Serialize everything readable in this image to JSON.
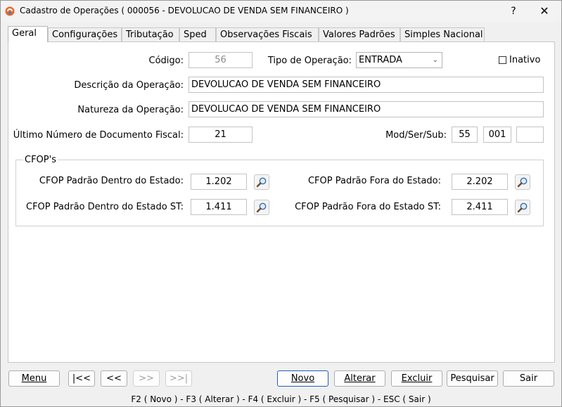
{
  "window": {
    "title": "Cadastro de Operações ( 000056 - DEVOLUCAO DE VENDA SEM FINANCEIRO )",
    "help_glyph": "?",
    "close_glyph": "✕"
  },
  "tabs": [
    {
      "label": "Geral",
      "active": true
    },
    {
      "label": "Configurações",
      "active": false
    },
    {
      "label": "Tributação",
      "active": false
    },
    {
      "label": "Sped",
      "active": false
    },
    {
      "label": "Observações Fiscais",
      "active": false
    },
    {
      "label": "Valores Padrões",
      "active": false
    },
    {
      "label": "Simples Nacional",
      "active": false
    }
  ],
  "form": {
    "codigo_label": "Código:",
    "codigo_value": "56",
    "tipo_label": "Tipo de Operação:",
    "tipo_value": "ENTRADA",
    "inativo_label": "Inativo",
    "descricao_label": "Descrição da Operação:",
    "descricao_value": "DEVOLUCAO DE VENDA SEM FINANCEIRO",
    "natureza_label": "Natureza da Operação:",
    "natureza_value": "DEVOLUCAO DE VENDA SEM FINANCEIRO",
    "ultimo_label": "Último Número de Documento Fiscal:",
    "ultimo_value": "21",
    "modser_label": "Mod/Ser/Sub:",
    "mod_value": "55",
    "ser_value": "001",
    "sub_value": ""
  },
  "cfop": {
    "group_title": "CFOP's",
    "dentro_label": "CFOP Padrão Dentro do Estado:",
    "dentro_value": "1.202",
    "fora_label": "CFOP Padrão Fora do Estado:",
    "fora_value": "2.202",
    "dentro_st_label": "CFOP Padrão Dentro do Estado ST:",
    "dentro_st_value": "1.411",
    "fora_st_label": "CFOP Padrão Fora do Estado ST:",
    "fora_st_value": "2.411"
  },
  "buttons": {
    "menu": "Menu",
    "first": "|<<",
    "prev": "<<",
    "next": ">>",
    "last": ">>|",
    "novo": "Novo",
    "alterar": "Alterar",
    "excluir": "Excluir",
    "pesquisar": "Pesquisar",
    "sair": "Sair"
  },
  "status": {
    "shortcuts": "F2 ( Novo )  -  F3 ( Alterar )  -  F4 ( Excluir )  -  F5 ( Pesquisar )  -  ESC ( Sair )"
  },
  "colors": {
    "accent": "#1f5fbf",
    "icon_orange": "#e86a2c",
    "icon_blue": "#3d7fd0"
  }
}
